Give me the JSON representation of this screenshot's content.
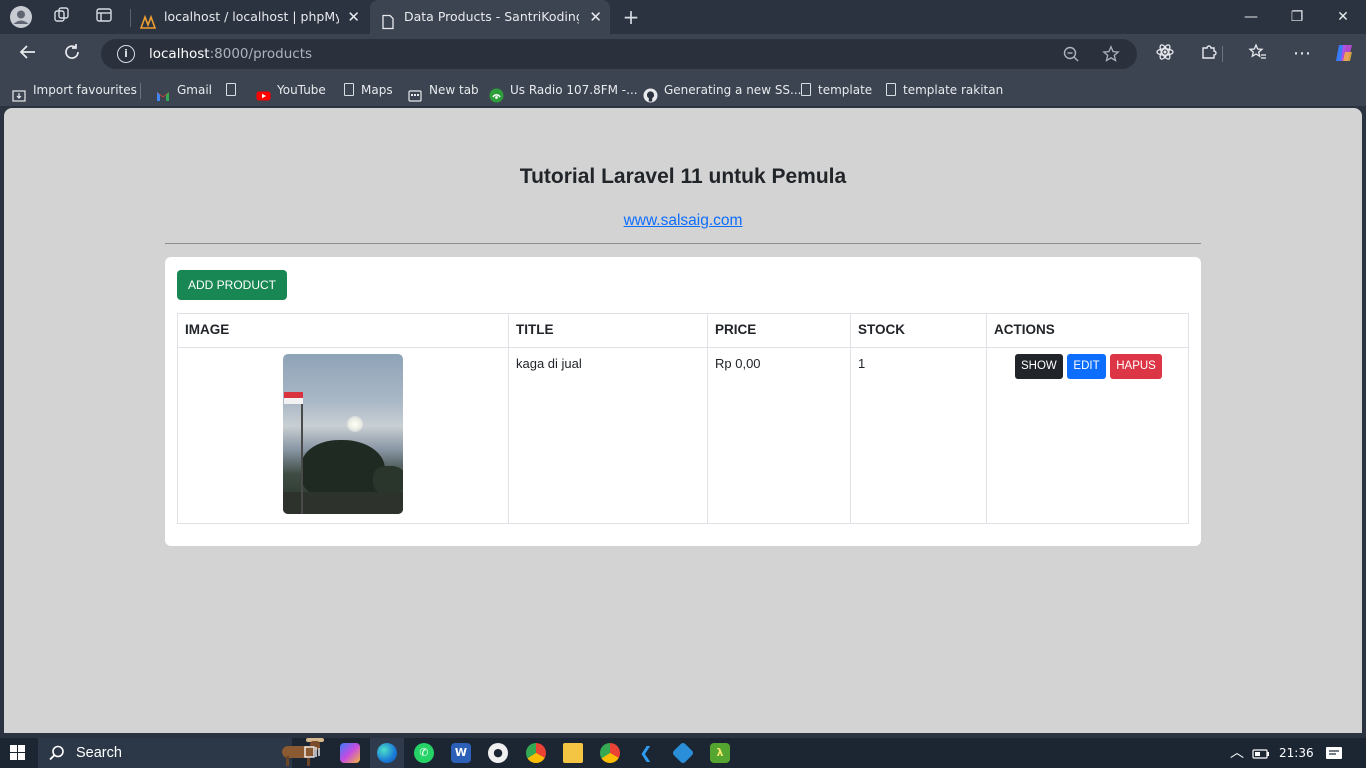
{
  "browser": {
    "tabs": [
      {
        "title": "localhost / localhost | phpMyAdmin",
        "active": false
      },
      {
        "title": "Data Products - SantriKoding.com",
        "active": true
      }
    ],
    "url_host": "localhost",
    "url_rest": ":8000/products",
    "bookmarks": [
      {
        "label": "Import favourites",
        "icon": "import-icon"
      },
      {
        "label": "Gmail",
        "icon": "gmail-icon"
      },
      {
        "label": "",
        "icon": "page-icon"
      },
      {
        "label": "YouTube",
        "icon": "youtube-icon"
      },
      {
        "label": "Maps",
        "icon": "page-icon"
      },
      {
        "label": "New tab",
        "icon": "newtab-icon"
      },
      {
        "label": "Us Radio 107.8FM -...",
        "icon": "radio-icon"
      },
      {
        "label": "Generating a new SS...",
        "icon": "github-icon"
      },
      {
        "label": "template",
        "icon": "page-icon"
      },
      {
        "label": "template rakitan",
        "icon": "page-icon"
      }
    ]
  },
  "page": {
    "heading": "Tutorial Laravel 11 untuk Pemula",
    "link": "www.salsaig.com",
    "add_button": "ADD PRODUCT",
    "table": {
      "headers": [
        "IMAGE",
        "TITLE",
        "PRICE",
        "STOCK",
        "ACTIONS"
      ],
      "rows": [
        {
          "title": "kaga di jual",
          "price": "Rp 0,00",
          "stock": "1"
        }
      ],
      "actions": {
        "show": "SHOW",
        "edit": "EDIT",
        "delete": "HAPUS"
      }
    }
  },
  "taskbar": {
    "search_label": "Search",
    "time": "21:36"
  },
  "colors": {
    "success": "#198754",
    "primary": "#0d6efd",
    "danger": "#dc3545",
    "dark": "#212529",
    "page_bg": "#d3d3d3"
  }
}
